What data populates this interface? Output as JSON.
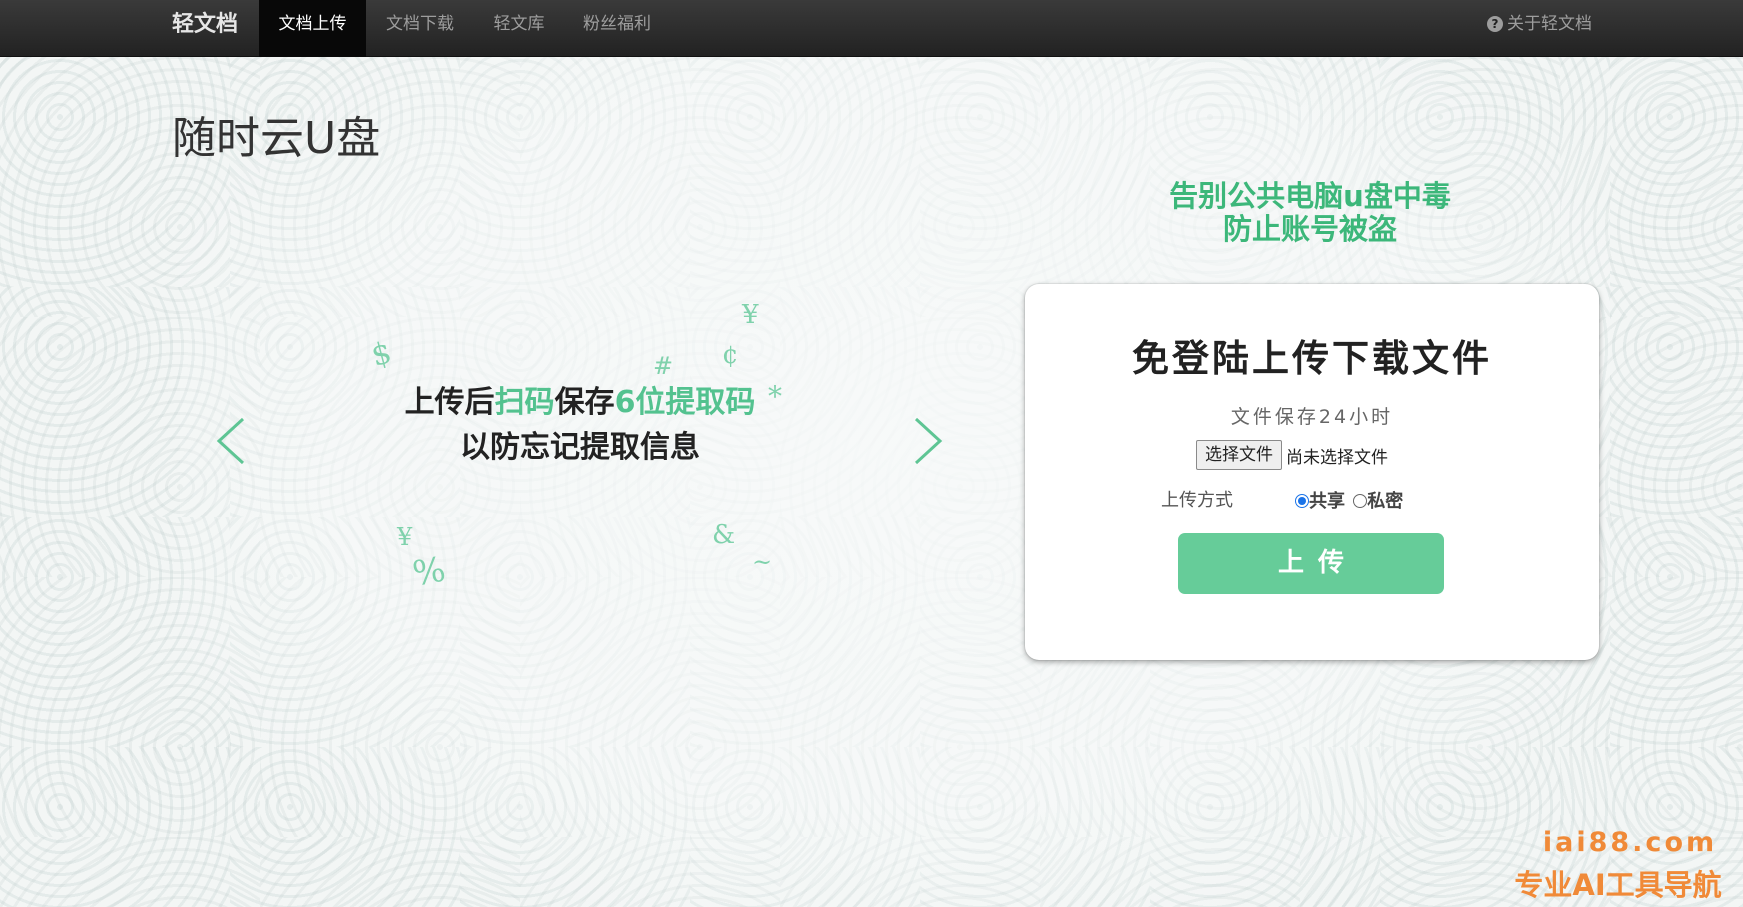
{
  "navbar": {
    "brand": "轻文档",
    "items": [
      {
        "label": "文档上传",
        "active": true
      },
      {
        "label": "文档下载",
        "active": false
      },
      {
        "label": "轻文库",
        "active": false
      },
      {
        "label": "粉丝福利",
        "active": false
      }
    ],
    "about_label": "关于轻文档",
    "about_icon": "question-circle-icon"
  },
  "page": {
    "title": "随时云U盘"
  },
  "carousel": {
    "line1_part1": "上传后",
    "line1_highlight1": "扫码",
    "line1_part2": "保存",
    "line1_highlight2": "6位提取码",
    "line2": "以防忘记提取信息",
    "prev_icon": "chevron-left-icon",
    "next_icon": "chevron-right-icon",
    "decorations": [
      "$",
      "¥",
      "¢",
      "#",
      "*",
      "¥",
      "%",
      "&",
      "~"
    ],
    "accent_color": "#53c28f"
  },
  "slogan": {
    "line1": "告别公共电脑u盘中毒",
    "line2": "防止账号被盗",
    "color": "#3cb77a"
  },
  "upload_card": {
    "title": "免登陆上传下载文件",
    "subtitle": "文件保存24小时",
    "file_button_label": "选择文件",
    "file_status": "尚未选择文件",
    "mode_label": "上传方式",
    "options": [
      {
        "label": "共享",
        "checked": true
      },
      {
        "label": "私密",
        "checked": false
      }
    ],
    "submit_label": "上传",
    "button_color": "#66cc99"
  },
  "watermark": {
    "line1": "iai88.com",
    "line2": "专业AI工具导航",
    "color": "#f08a38"
  }
}
